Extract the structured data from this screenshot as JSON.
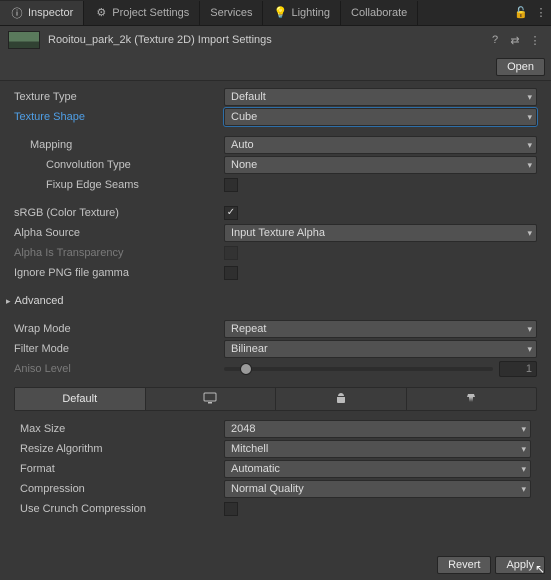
{
  "tabs": {
    "inspector": "Inspector",
    "projectSettings": "Project Settings",
    "services": "Services",
    "lighting": "Lighting",
    "collaborate": "Collaborate"
  },
  "header": {
    "title": "Rooitou_park_2k (Texture 2D) Import Settings",
    "open": "Open"
  },
  "props": {
    "textureType": {
      "label": "Texture Type",
      "value": "Default"
    },
    "textureShape": {
      "label": "Texture Shape",
      "value": "Cube"
    },
    "mapping": {
      "label": "Mapping",
      "value": "Auto"
    },
    "convolutionType": {
      "label": "Convolution Type",
      "value": "None"
    },
    "fixupEdgeSeams": {
      "label": "Fixup Edge Seams"
    },
    "srgb": {
      "label": "sRGB (Color Texture)"
    },
    "alphaSource": {
      "label": "Alpha Source",
      "value": "Input Texture Alpha"
    },
    "alphaIsTransparency": {
      "label": "Alpha Is Transparency"
    },
    "ignorePngGamma": {
      "label": "Ignore PNG file gamma"
    },
    "advanced": {
      "label": "Advanced"
    },
    "wrapMode": {
      "label": "Wrap Mode",
      "value": "Repeat"
    },
    "filterMode": {
      "label": "Filter Mode",
      "value": "Bilinear"
    },
    "anisoLevel": {
      "label": "Aniso Level",
      "value": "1"
    }
  },
  "platforms": {
    "default": "Default",
    "maxSize": {
      "label": "Max Size",
      "value": "2048"
    },
    "resizeAlgorithm": {
      "label": "Resize Algorithm",
      "value": "Mitchell"
    },
    "format": {
      "label": "Format",
      "value": "Automatic"
    },
    "compression": {
      "label": "Compression",
      "value": "Normal Quality"
    },
    "useCrunch": {
      "label": "Use Crunch Compression"
    }
  },
  "footer": {
    "revert": "Revert",
    "apply": "Apply"
  }
}
